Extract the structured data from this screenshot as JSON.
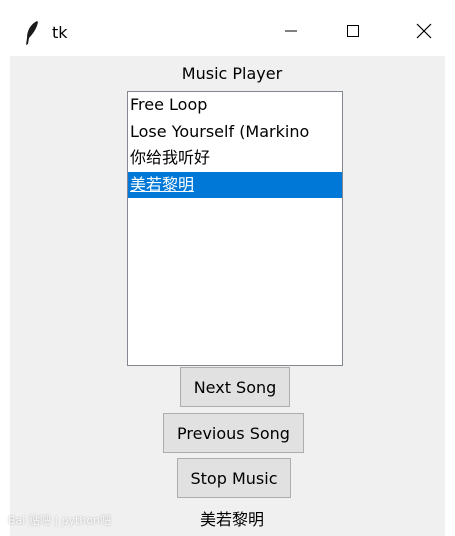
{
  "window": {
    "title": "tk"
  },
  "app": {
    "heading": "Music Player",
    "songs": [
      "Free Loop",
      "Lose Yourself (Markino",
      "你给我听好",
      "美若黎明"
    ],
    "selected_index": 3,
    "buttons": {
      "next": "Next Song",
      "previous": "Previous Song",
      "stop": "Stop Music"
    },
    "now_playing": "美若黎明"
  },
  "watermark": "Bai 贴吧 | python吧",
  "colors": {
    "selection": "#0078d7",
    "client_bg": "#f0f0f0",
    "button_bg": "#e1e1e1"
  }
}
